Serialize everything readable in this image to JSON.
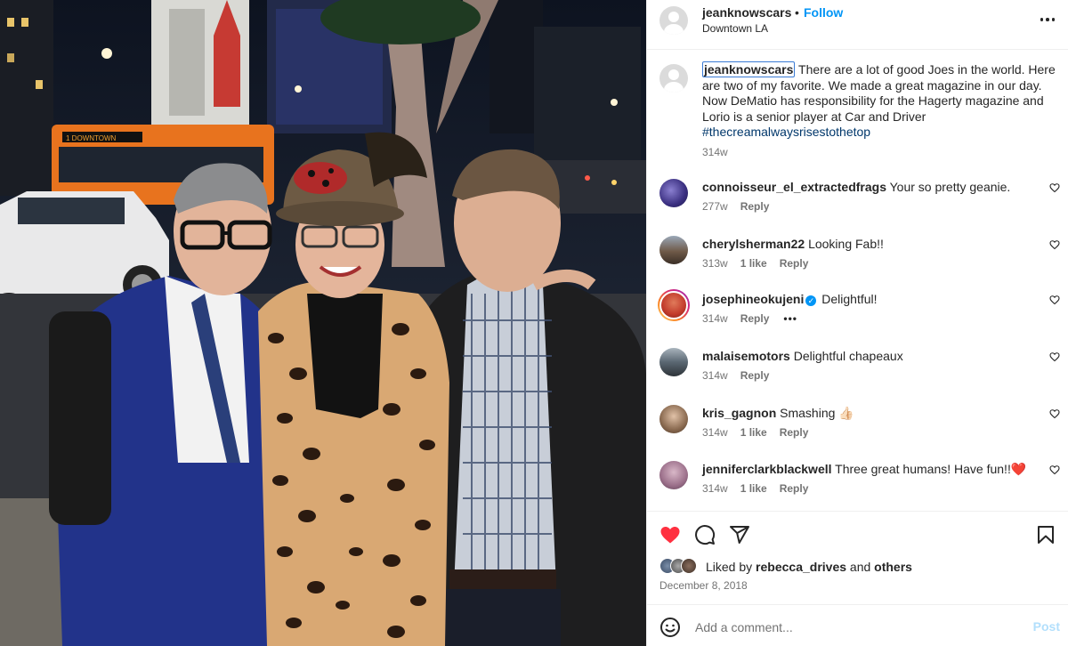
{
  "post": {
    "username": "jeanknowscars",
    "separator": "•",
    "follow_label": "Follow",
    "location": "Downtown LA",
    "more_icon": "more-horizontal-icon"
  },
  "caption": {
    "username": "jeanknowscars",
    "text": " There are a lot of good Joes in the world. Here are two of my favorite. We made a great magazine in our day. Now DeMatio has responsibility for the Hagerty magazine and Lorio is a senior player at Car and Driver ",
    "hashtag": "#thecreamalwaysrisestothetop",
    "time": "314w"
  },
  "comments": [
    {
      "username": "connoisseur_el_extractedfrags",
      "text": "Your so pretty geanie.",
      "time": "277w",
      "likes": "",
      "reply": "Reply",
      "avatar_color": "#4a3b8c"
    },
    {
      "username": "cherylsherman22",
      "text": "Looking Fab!!",
      "time": "313w",
      "likes": "1 like",
      "reply": "Reply",
      "avatar_color": "#6f5a48"
    },
    {
      "username": "josephineokujeni",
      "text": "Delightful!",
      "time": "314w",
      "likes": "",
      "reply": "Reply",
      "more": "•••",
      "verified": true,
      "avatar_color": "#c23a2b"
    },
    {
      "username": "malaisemotors",
      "text": "Delightful chapeaux",
      "time": "314w",
      "likes": "",
      "reply": "Reply",
      "avatar_color": "#5a6772"
    },
    {
      "username": "kris_gagnon",
      "text": "Smashing 👍🏻",
      "time": "314w",
      "likes": "1 like",
      "reply": "Reply",
      "avatar_color": "#8a6a50"
    },
    {
      "username": "jenniferclarkblackwell",
      "text": "Three great humans! Have fun!!❤️",
      "time": "314w",
      "likes": "1 like",
      "reply": "Reply",
      "avatar_color": "#9b6f8a"
    }
  ],
  "actions": {
    "like_icon": "heart-filled-icon",
    "comment_icon": "comment-icon",
    "share_icon": "share-icon",
    "save_icon": "bookmark-icon",
    "liked_by_prefix": "Liked by ",
    "liked_by_user": "rebecca_drives",
    "liked_by_and": " and ",
    "liked_by_others": "others",
    "date": "December 8, 2018"
  },
  "add_comment": {
    "placeholder": "Add a comment...",
    "post_label": "Post",
    "emoji_icon": "emoji-icon"
  },
  "colors": {
    "accent": "#0095f6",
    "like": "#ff3040",
    "hashtag": "#00376b"
  }
}
